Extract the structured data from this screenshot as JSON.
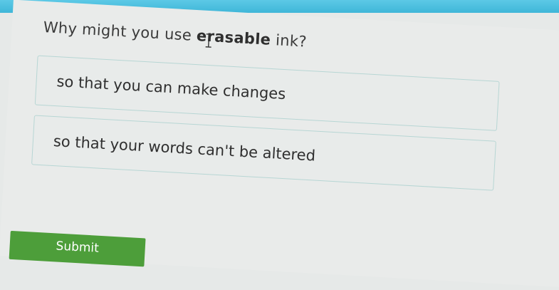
{
  "question": {
    "prefix": "Why might you use ",
    "bold_word": "erasable",
    "suffix": " ink?"
  },
  "options": [
    {
      "label": "so that you can make changes"
    },
    {
      "label": "so that your words can't be altered"
    }
  ],
  "submit": {
    "label": "Submit"
  },
  "colors": {
    "header_strip": "#3fb6d8",
    "option_border": "#b7d6d4",
    "submit_bg": "#4d9e3a"
  }
}
